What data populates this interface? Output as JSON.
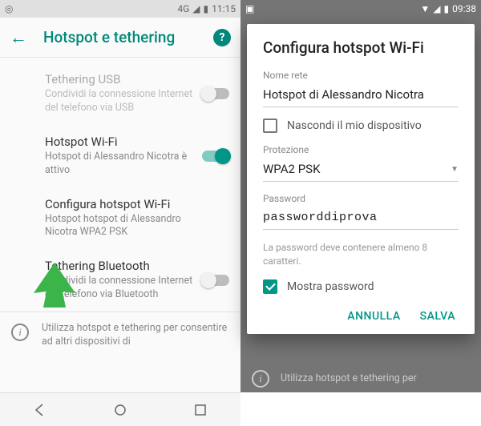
{
  "left": {
    "status": {
      "net": "4G",
      "time": "11:15"
    },
    "header": {
      "title": "Hotspot e tethering"
    },
    "items": {
      "usb": {
        "title": "Tethering USB",
        "sub": "Condividi la connessione Internet del telefono via USB"
      },
      "wifi": {
        "title": "Hotspot Wi-Fi",
        "sub": "Hotspot di Alessandro Nicotra è attivo"
      },
      "config": {
        "title": "Configura hotspot Wi-Fi",
        "sub_line1": "Hotspot hotspot di Alessandro",
        "sub_line2": "Nicotra WPA2 PSK"
      },
      "bt": {
        "title": "Tethering Bluetooth",
        "sub": "Condividi la connessione Internet del telefono via Bluetooth"
      },
      "info": "Utilizza hotspot e tethering per consentire ad altri dispositivi di"
    }
  },
  "right": {
    "status": {
      "time": "09:38"
    },
    "dialog": {
      "title": "Configura hotspot Wi-Fi",
      "name_label": "Nome rete",
      "name_value": "Hotspot di Alessandro Nicotra",
      "hide_label": "Nascondi il mio dispositivo",
      "security_label": "Protezione",
      "security_value": "WPA2 PSK",
      "password_label": "Password",
      "password_value": "passworddiprova",
      "hint": "La password deve contenere almeno 8 caratteri.",
      "show_pw": "Mostra password",
      "cancel": "ANNULLA",
      "save": "SALVA"
    },
    "dimtext": "Utilizza hotspot e tethering per"
  }
}
